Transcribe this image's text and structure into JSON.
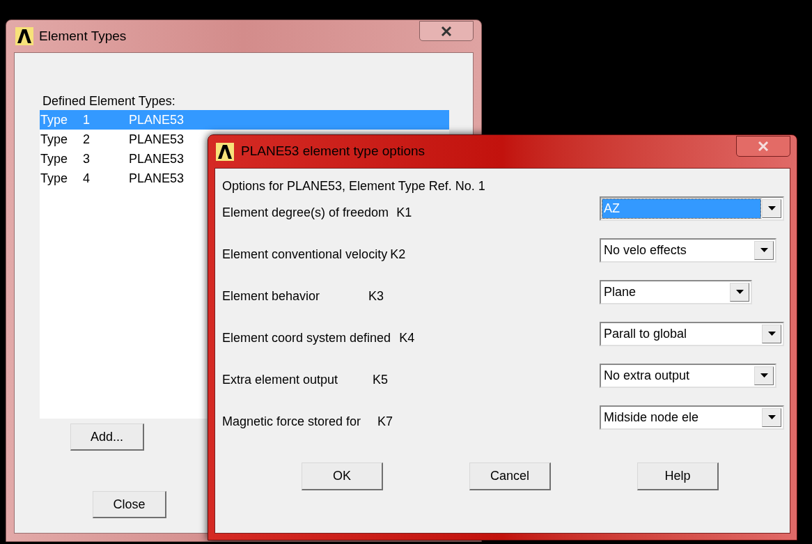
{
  "element_types_window": {
    "title": "Element Types",
    "list_label": "Defined Element Types:",
    "types": [
      {
        "label": "Type",
        "number": "1",
        "name": "PLANE53",
        "selected": true
      },
      {
        "label": "Type",
        "number": "2",
        "name": "PLANE53",
        "selected": false
      },
      {
        "label": "Type",
        "number": "3",
        "name": "PLANE53",
        "selected": false
      },
      {
        "label": "Type",
        "number": "4",
        "name": "PLANE53",
        "selected": false
      }
    ],
    "buttons": [
      "Add...",
      "Close"
    ]
  },
  "options_dialog": {
    "title": "PLANE53 element type options",
    "heading": "Options for PLANE53, Element Type Ref. No. 1",
    "options": [
      {
        "label": "Element degree(s) of freedom",
        "key": "K1",
        "value": "AZ",
        "focused": true
      },
      {
        "label": "Element conventional velocity",
        "key": "K2",
        "value": "No velo effects",
        "focused": false
      },
      {
        "label": "Element behavior",
        "key": "K3",
        "value": "Plane",
        "focused": false
      },
      {
        "label": "Element coord system defined",
        "key": "K4",
        "value": "Parall to global",
        "focused": false
      },
      {
        "label": "Extra element output",
        "key": "K5",
        "value": "No extra output",
        "focused": false
      },
      {
        "label": "Magnetic force stored for",
        "key": "K7",
        "value": "Midside node ele",
        "focused": false
      }
    ],
    "buttons": [
      "OK",
      "Cancel",
      "Help"
    ]
  }
}
